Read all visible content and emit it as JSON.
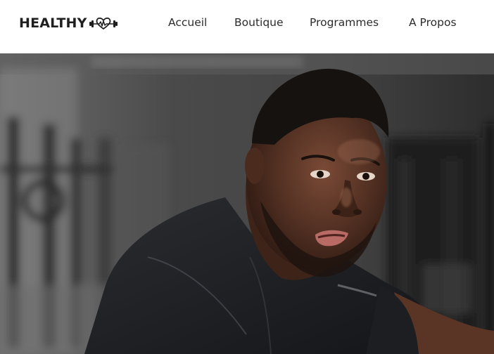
{
  "brand": {
    "name": "HEALTHY",
    "icon": "heart-dumbbell-icon"
  },
  "nav": {
    "items": [
      {
        "label": "Accueil"
      },
      {
        "label": "Boutique"
      },
      {
        "label": "Programmes"
      },
      {
        "label": "A Propos"
      }
    ]
  },
  "hero": {
    "image": "man-in-gym-photo"
  }
}
